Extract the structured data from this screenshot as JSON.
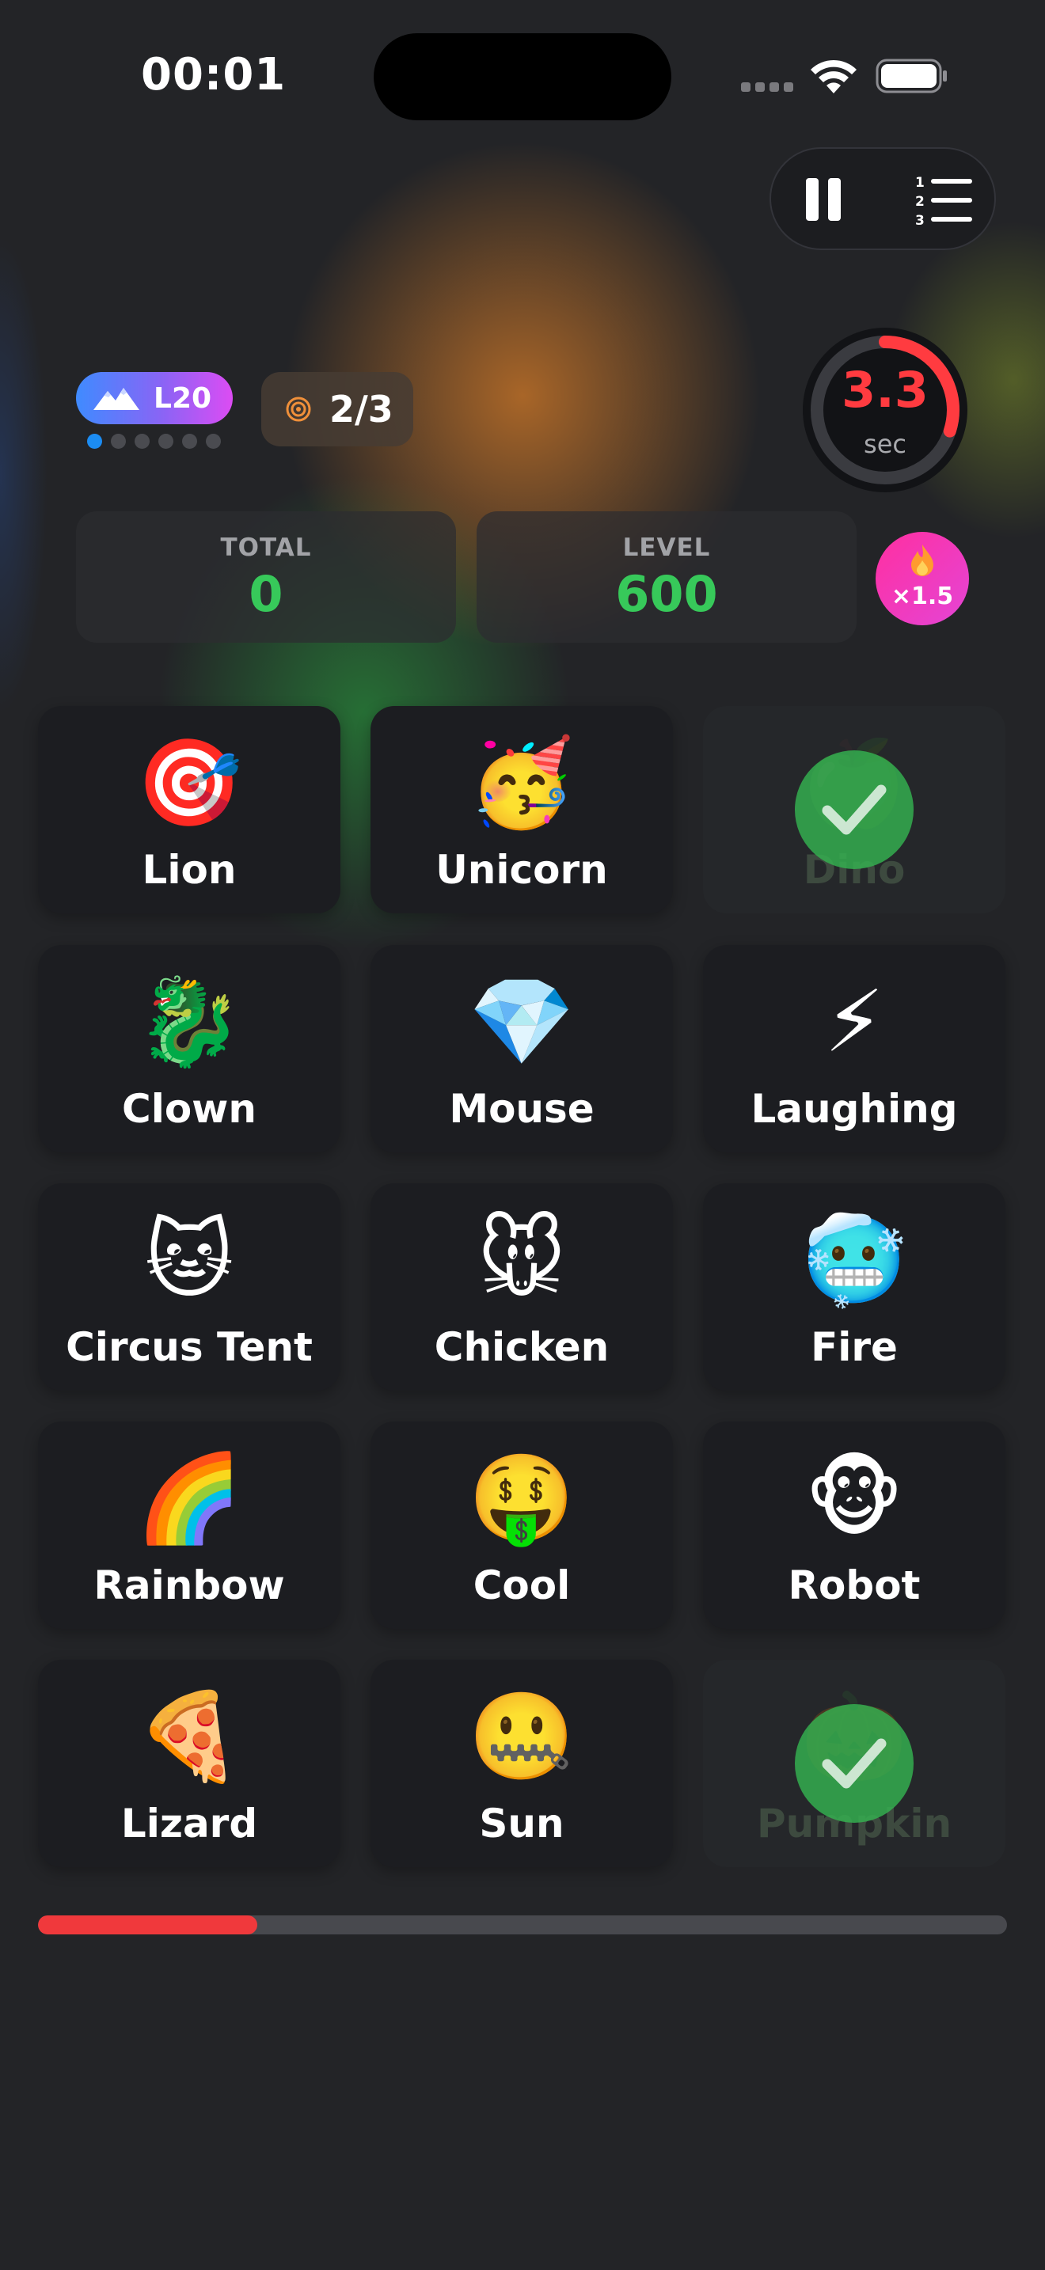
{
  "status_bar": {
    "time": "00:01"
  },
  "controls": {
    "pause_icon": "pause-icon",
    "leaderboard_icon": "numbered-list-icon"
  },
  "level": {
    "badge_icon": "mountain-icon",
    "label": "L20",
    "dots_total": 6,
    "dots_active_index": 0
  },
  "target": {
    "icon": "target-icon",
    "text": "2/3"
  },
  "timer": {
    "value": "3.3",
    "unit": "sec",
    "remaining_fraction": 0.3,
    "color": "#ff3b40"
  },
  "stats": {
    "total_label": "TOTAL",
    "total_value": "0",
    "level_label": "LEVEL",
    "level_value": "600"
  },
  "multiplier": {
    "icon": "flame-icon",
    "text": "×1.5"
  },
  "tiles": [
    {
      "emoji": "🎯",
      "label": "Lion",
      "done": false
    },
    {
      "emoji": "🥳",
      "label": "Unicorn",
      "done": false
    },
    {
      "emoji": "🍏",
      "label": "Dino",
      "done": true
    },
    {
      "emoji": "🐉",
      "label": "Clown",
      "done": false
    },
    {
      "emoji": "💎",
      "label": "Mouse",
      "done": false
    },
    {
      "emoji": "⚡",
      "label": "Laughing",
      "done": false
    },
    {
      "emoji": "🐱",
      "label": "Circus Tent",
      "done": false
    },
    {
      "emoji": "🐭",
      "label": "Chicken",
      "done": false
    },
    {
      "emoji": "🥶",
      "label": "Fire",
      "done": false
    },
    {
      "emoji": "🌈",
      "label": "Rainbow",
      "done": false
    },
    {
      "emoji": "🤑",
      "label": "Cool",
      "done": false
    },
    {
      "emoji": "🐵",
      "label": "Robot",
      "done": false
    },
    {
      "emoji": "🍕",
      "label": "Lizard",
      "done": false
    },
    {
      "emoji": "🤐",
      "label": "Sun",
      "done": false
    },
    {
      "emoji": "🎃",
      "label": "Pumpkin",
      "done": true
    }
  ],
  "progress": {
    "fraction": 0.226,
    "color": "#f0393c"
  },
  "colors": {
    "background": "#232427",
    "accent_green": "#37c95a",
    "accent_red": "#ff3b40"
  }
}
